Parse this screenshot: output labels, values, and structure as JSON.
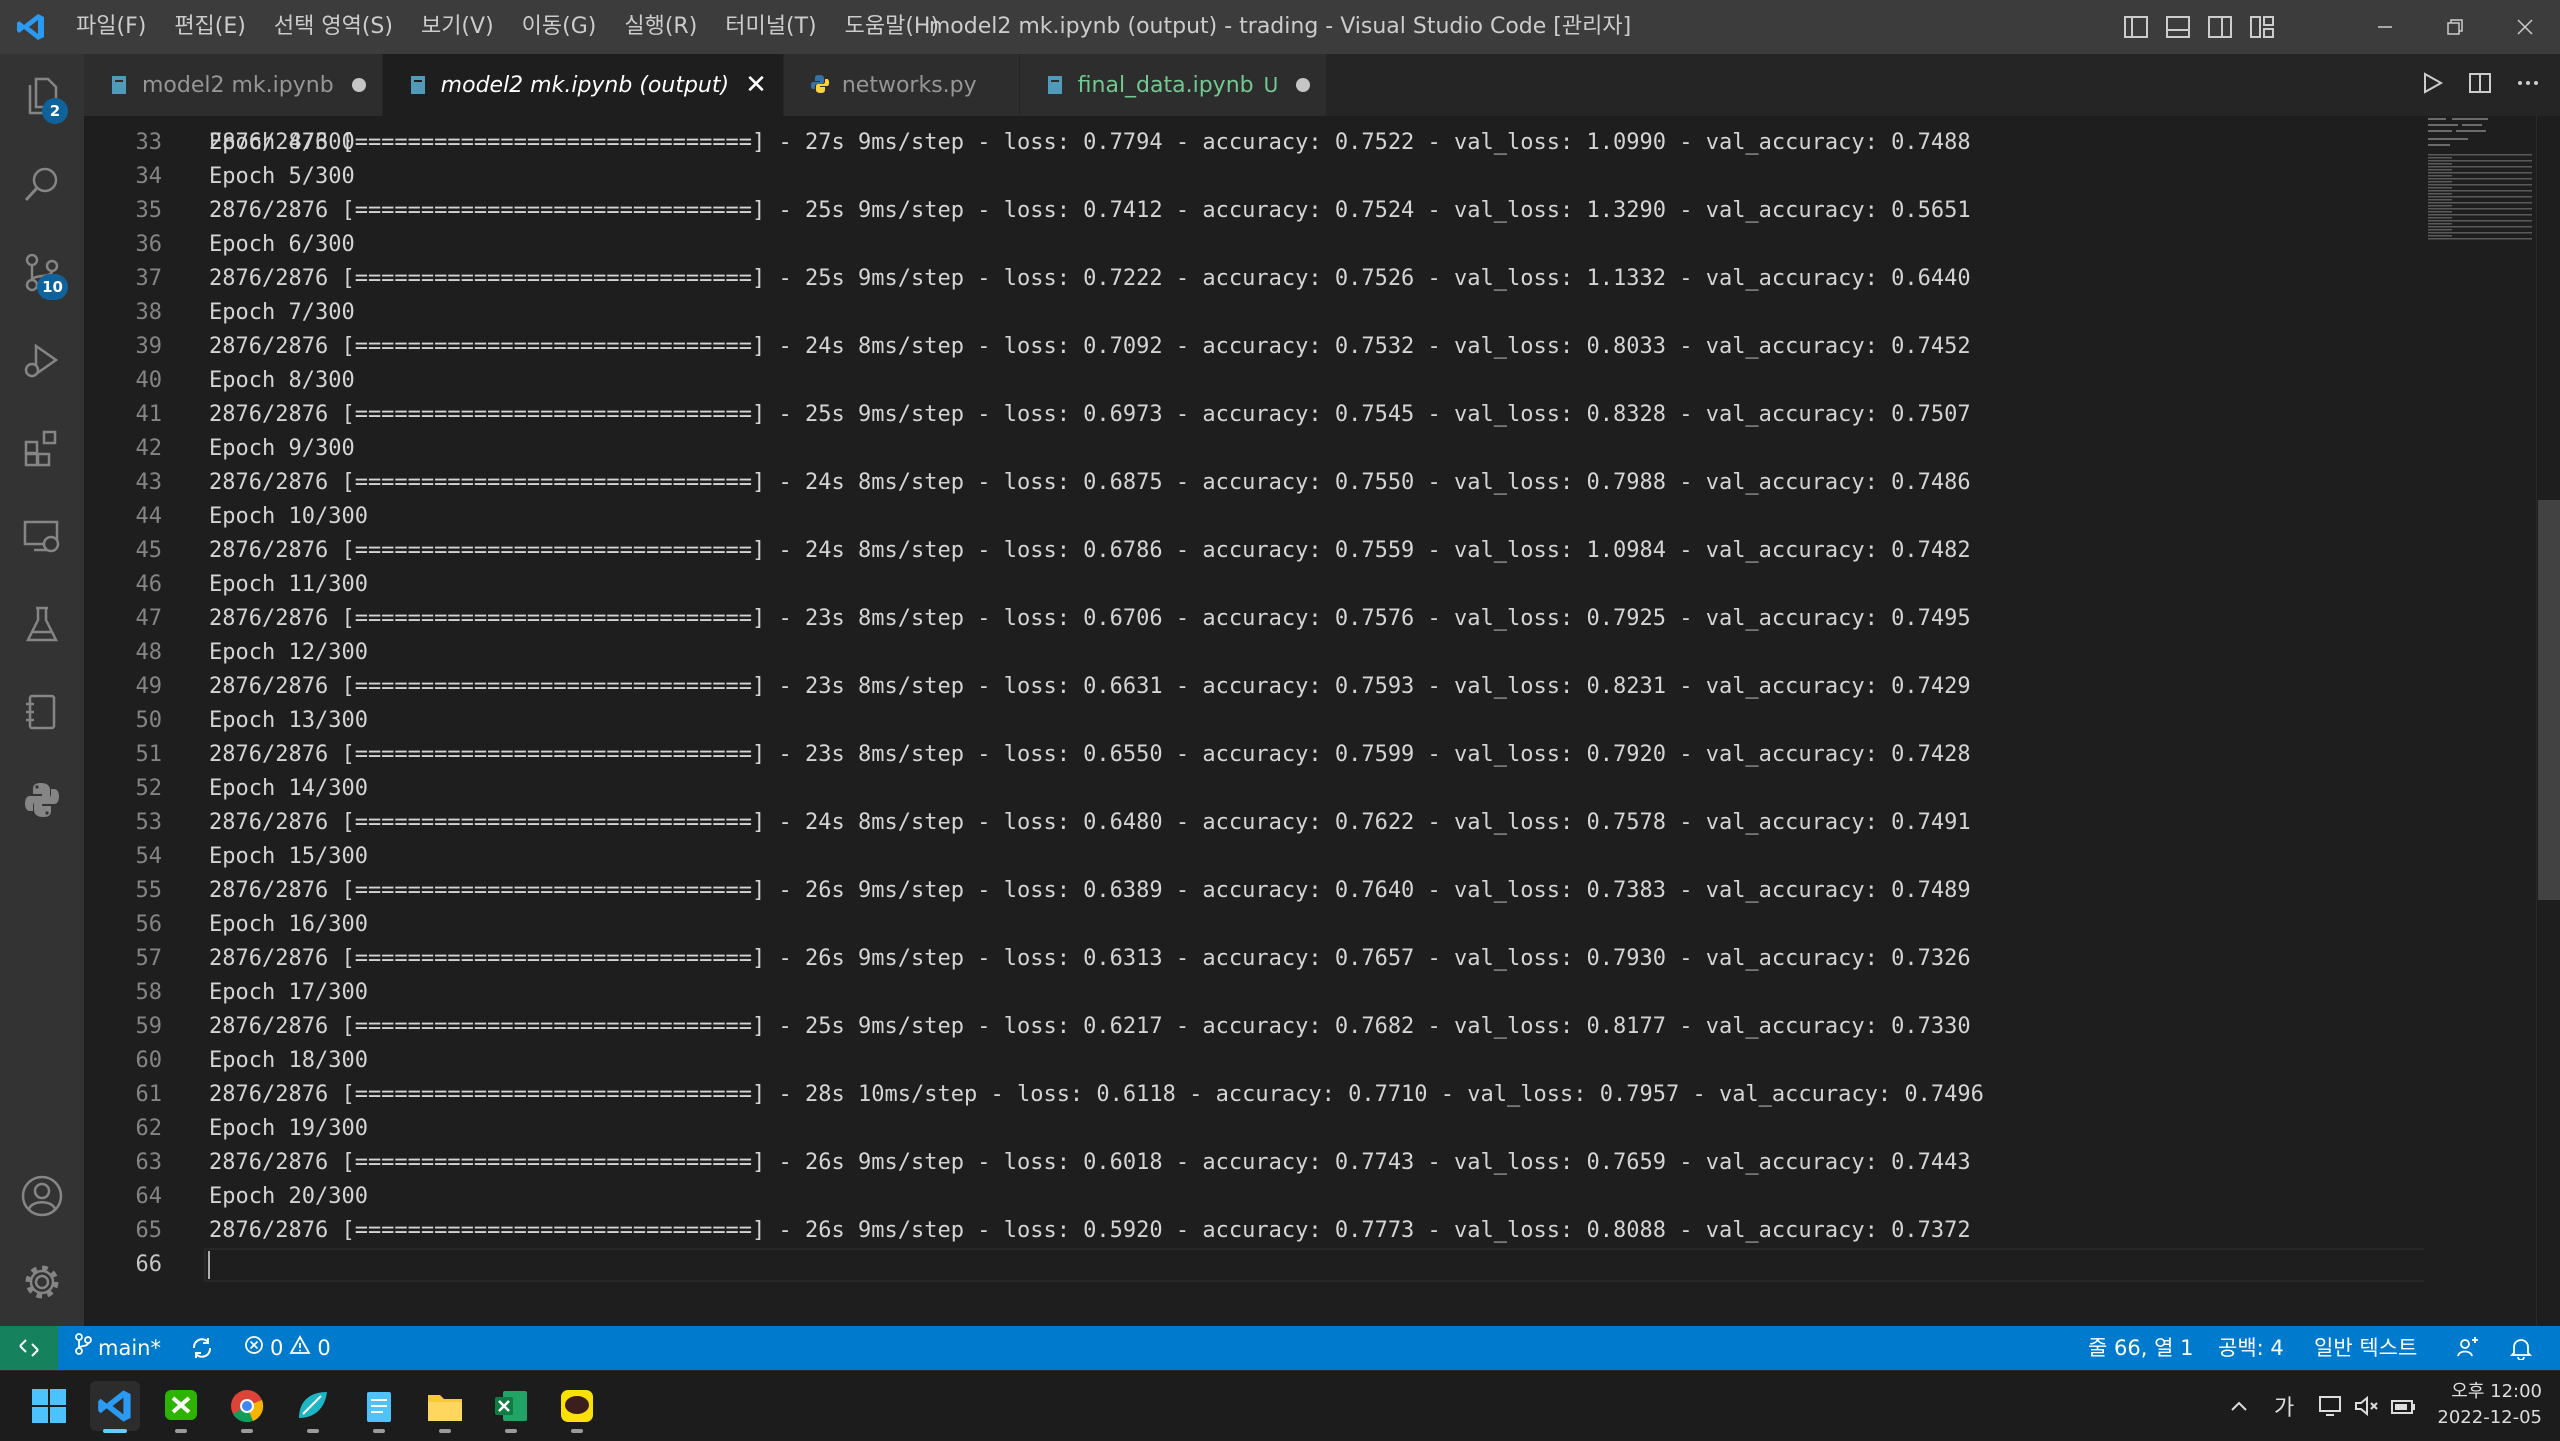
{
  "window": {
    "title": "model2 mk.ipynb (output) - trading - Visual Studio Code [관리자]",
    "menu": [
      "파일(F)",
      "편집(E)",
      "선택 영역(S)",
      "보기(V)",
      "이동(G)",
      "실행(R)",
      "터미널(T)",
      "도움말(H)"
    ]
  },
  "activity_bar": {
    "explorer_badge": "2",
    "scm_badge": "10"
  },
  "tabs": [
    {
      "label": "model2 mk.ipynb",
      "state": "dirty"
    },
    {
      "label": "model2 mk.ipynb (output)",
      "state": "active"
    },
    {
      "label": "networks.py",
      "state": "normal"
    },
    {
      "label": "final_data.ipynb",
      "suffix": "U",
      "state": "untracked-dirty"
    }
  ],
  "editor": {
    "partial_top": "Epoch 4/300",
    "lines": [
      {
        "n": "33",
        "text": "2876/2876 [==============================] - 27s 9ms/step - loss: 0.7794 - accuracy: 0.7522 - val_loss: 1.0990 - val_accuracy: 0.7488"
      },
      {
        "n": "34",
        "text": "Epoch 5/300"
      },
      {
        "n": "35",
        "text": "2876/2876 [==============================] - 25s 9ms/step - loss: 0.7412 - accuracy: 0.7524 - val_loss: 1.3290 - val_accuracy: 0.5651"
      },
      {
        "n": "36",
        "text": "Epoch 6/300"
      },
      {
        "n": "37",
        "text": "2876/2876 [==============================] - 25s 9ms/step - loss: 0.7222 - accuracy: 0.7526 - val_loss: 1.1332 - val_accuracy: 0.6440"
      },
      {
        "n": "38",
        "text": "Epoch 7/300"
      },
      {
        "n": "39",
        "text": "2876/2876 [==============================] - 24s 8ms/step - loss: 0.7092 - accuracy: 0.7532 - val_loss: 0.8033 - val_accuracy: 0.7452"
      },
      {
        "n": "40",
        "text": "Epoch 8/300"
      },
      {
        "n": "41",
        "text": "2876/2876 [==============================] - 25s 9ms/step - loss: 0.6973 - accuracy: 0.7545 - val_loss: 0.8328 - val_accuracy: 0.7507"
      },
      {
        "n": "42",
        "text": "Epoch 9/300"
      },
      {
        "n": "43",
        "text": "2876/2876 [==============================] - 24s 8ms/step - loss: 0.6875 - accuracy: 0.7550 - val_loss: 0.7988 - val_accuracy: 0.7486"
      },
      {
        "n": "44",
        "text": "Epoch 10/300"
      },
      {
        "n": "45",
        "text": "2876/2876 [==============================] - 24s 8ms/step - loss: 0.6786 - accuracy: 0.7559 - val_loss: 1.0984 - val_accuracy: 0.7482"
      },
      {
        "n": "46",
        "text": "Epoch 11/300"
      },
      {
        "n": "47",
        "text": "2876/2876 [==============================] - 23s 8ms/step - loss: 0.6706 - accuracy: 0.7576 - val_loss: 0.7925 - val_accuracy: 0.7495"
      },
      {
        "n": "48",
        "text": "Epoch 12/300"
      },
      {
        "n": "49",
        "text": "2876/2876 [==============================] - 23s 8ms/step - loss: 0.6631 - accuracy: 0.7593 - val_loss: 0.8231 - val_accuracy: 0.7429"
      },
      {
        "n": "50",
        "text": "Epoch 13/300"
      },
      {
        "n": "51",
        "text": "2876/2876 [==============================] - 23s 8ms/step - loss: 0.6550 - accuracy: 0.7599 - val_loss: 0.7920 - val_accuracy: 0.7428"
      },
      {
        "n": "52",
        "text": "Epoch 14/300"
      },
      {
        "n": "53",
        "text": "2876/2876 [==============================] - 24s 8ms/step - loss: 0.6480 - accuracy: 0.7622 - val_loss: 0.7578 - val_accuracy: 0.7491"
      },
      {
        "n": "54",
        "text": "Epoch 15/300"
      },
      {
        "n": "55",
        "text": "2876/2876 [==============================] - 26s 9ms/step - loss: 0.6389 - accuracy: 0.7640 - val_loss: 0.7383 - val_accuracy: 0.7489"
      },
      {
        "n": "56",
        "text": "Epoch 16/300"
      },
      {
        "n": "57",
        "text": "2876/2876 [==============================] - 26s 9ms/step - loss: 0.6313 - accuracy: 0.7657 - val_loss: 0.7930 - val_accuracy: 0.7326"
      },
      {
        "n": "58",
        "text": "Epoch 17/300"
      },
      {
        "n": "59",
        "text": "2876/2876 [==============================] - 25s 9ms/step - loss: 0.6217 - accuracy: 0.7682 - val_loss: 0.8177 - val_accuracy: 0.7330"
      },
      {
        "n": "60",
        "text": "Epoch 18/300"
      },
      {
        "n": "61",
        "text": "2876/2876 [==============================] - 28s 10ms/step - loss: 0.6118 - accuracy: 0.7710 - val_loss: 0.7957 - val_accuracy: 0.7496"
      },
      {
        "n": "62",
        "text": "Epoch 19/300"
      },
      {
        "n": "63",
        "text": "2876/2876 [==============================] - 26s 9ms/step - loss: 0.6018 - accuracy: 0.7743 - val_loss: 0.7659 - val_accuracy: 0.7443"
      },
      {
        "n": "64",
        "text": "Epoch 20/300"
      },
      {
        "n": "65",
        "text": "2876/2876 [==============================] - 26s 9ms/step - loss: 0.5920 - accuracy: 0.7773 - val_loss: 0.8088 - val_accuracy: 0.7372"
      },
      {
        "n": "66",
        "text": ""
      }
    ]
  },
  "status_bar": {
    "branch": "main*",
    "errors": "0",
    "warnings": "0",
    "cursor": "줄 66, 열 1",
    "indent": "공백: 4",
    "language": "일반 텍스트"
  },
  "taskbar": {
    "ime": "가",
    "time": "오후 12:00",
    "date": "2022-12-05"
  },
  "colors": {
    "status_bar": "#007acc",
    "remote": "#16825d",
    "badge": "#0e639c",
    "untracked": "#73c991"
  }
}
